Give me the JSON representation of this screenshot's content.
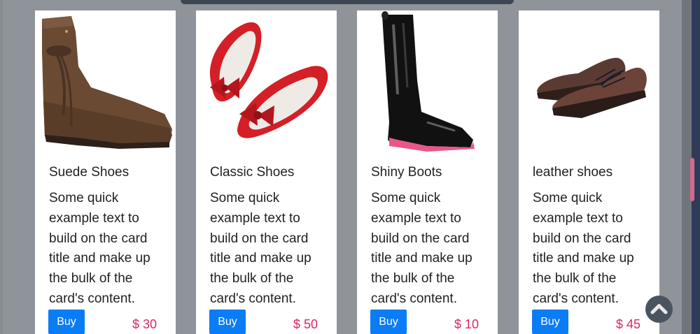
{
  "cards": [
    {
      "title": "Suede Shoes",
      "text": "Some quick example text to build on the card title and make up the bulk of the card's content.",
      "button": "Buy",
      "price": "$ 30",
      "image_icon": "suede-boot"
    },
    {
      "title": "Classic Shoes",
      "text": "Some quick example text to build on the card title and make up the bulk of the card's content.",
      "button": "Buy",
      "price": "$ 50",
      "image_icon": "red-flats"
    },
    {
      "title": "Shiny Boots",
      "text": "Some quick example text to build on the card title and make up the bulk of the card's content.",
      "button": "Buy",
      "price": "$ 10",
      "image_icon": "rain-boot"
    },
    {
      "title": "leather shoes",
      "text": "Some quick example text to build on the card title and make up the bulk of the card's content.",
      "button": "Buy",
      "price": "$ 45",
      "image_icon": "leather-oxfords"
    }
  ],
  "colors": {
    "accent": "#0a7cf5",
    "price": "#e0245e",
    "backdrop": "#8e9499"
  },
  "scroll_top_icon": "chevron-up-icon"
}
